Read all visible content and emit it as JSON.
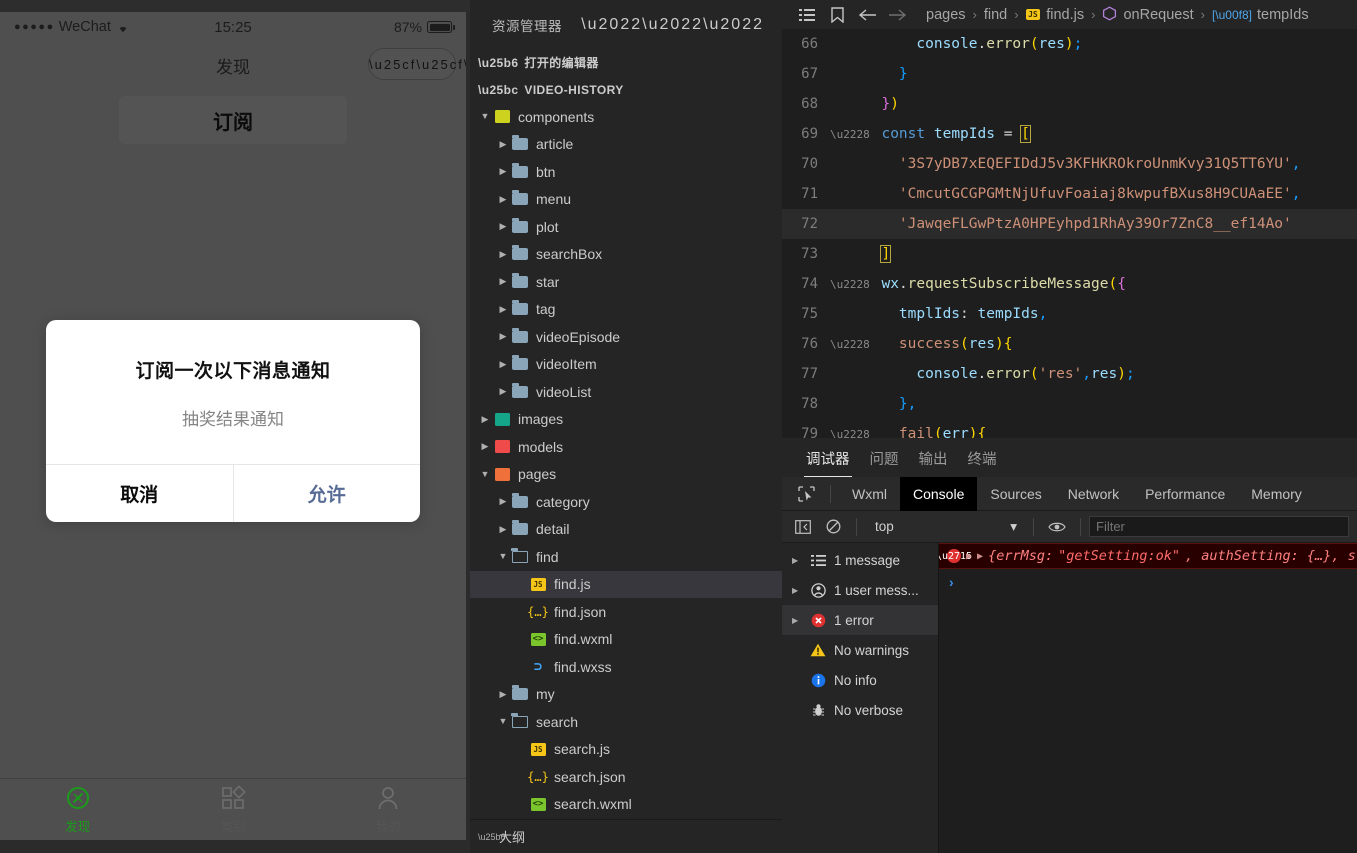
{
  "simulator": {
    "status_bar": {
      "signal_dots": "●●●●●",
      "carrier": "WeChat",
      "wifi_icon": "wifi-icon",
      "time": "15:25",
      "battery_percent": "87%"
    },
    "nav": {
      "title": "发现",
      "capsule_more_icon": "more-dots-icon",
      "capsule_target_icon": "target-icon"
    },
    "subscribe_button": "订阅",
    "modal": {
      "title": "订阅一次以下消息通知",
      "subtitle": "抽奖结果通知",
      "cancel_label": "取消",
      "allow_label": "允许",
      "allow_color": "#576b95"
    },
    "tabbar": [
      {
        "label": "发现",
        "icon": "compass-icon",
        "active": true,
        "color": "#1a9c1a"
      },
      {
        "label": "类别",
        "icon": "grid-icon",
        "active": false,
        "color": "#555555"
      },
      {
        "label": "我的",
        "icon": "person-icon",
        "active": false,
        "color": "#555555"
      }
    ]
  },
  "explorer": {
    "title": "资源管理器",
    "more_icon": "ellipsis-icon",
    "open_editors_label": "打开的编辑器",
    "project_label": "VIDEO-HISTORY",
    "outline_label": "大纲",
    "tree": [
      {
        "label": "components",
        "indent": 1,
        "kind": "folder-special",
        "icon": "folder-components-icon",
        "twisty": "down",
        "selected": false
      },
      {
        "label": "article",
        "indent": 2,
        "kind": "folder",
        "icon": "folder-icon",
        "twisty": "right",
        "selected": false
      },
      {
        "label": "btn",
        "indent": 2,
        "kind": "folder",
        "icon": "folder-icon",
        "twisty": "right",
        "selected": false
      },
      {
        "label": "menu",
        "indent": 2,
        "kind": "folder",
        "icon": "folder-icon",
        "twisty": "right",
        "selected": false
      },
      {
        "label": "plot",
        "indent": 2,
        "kind": "folder",
        "icon": "folder-icon",
        "twisty": "right",
        "selected": false
      },
      {
        "label": "searchBox",
        "indent": 2,
        "kind": "folder",
        "icon": "folder-icon",
        "twisty": "right",
        "selected": false
      },
      {
        "label": "star",
        "indent": 2,
        "kind": "folder",
        "icon": "folder-icon",
        "twisty": "right",
        "selected": false
      },
      {
        "label": "tag",
        "indent": 2,
        "kind": "folder",
        "icon": "folder-icon",
        "twisty": "right",
        "selected": false
      },
      {
        "label": "videoEpisode",
        "indent": 2,
        "kind": "folder",
        "icon": "folder-icon",
        "twisty": "right",
        "selected": false
      },
      {
        "label": "videoItem",
        "indent": 2,
        "kind": "folder",
        "icon": "folder-icon",
        "twisty": "right",
        "selected": false
      },
      {
        "label": "videoList",
        "indent": 2,
        "kind": "folder",
        "icon": "folder-icon",
        "twisty": "right",
        "selected": false
      },
      {
        "label": "images",
        "indent": 1,
        "kind": "folder-images",
        "icon": "folder-images-icon",
        "twisty": "right",
        "selected": false
      },
      {
        "label": "models",
        "indent": 1,
        "kind": "folder-models",
        "icon": "folder-models-icon",
        "twisty": "right",
        "selected": false
      },
      {
        "label": "pages",
        "indent": 1,
        "kind": "folder-pages",
        "icon": "folder-pages-icon",
        "twisty": "down",
        "selected": false
      },
      {
        "label": "category",
        "indent": 2,
        "kind": "folder",
        "icon": "folder-icon",
        "twisty": "right",
        "selected": false
      },
      {
        "label": "detail",
        "indent": 2,
        "kind": "folder",
        "icon": "folder-icon",
        "twisty": "right",
        "selected": false
      },
      {
        "label": "find",
        "indent": 2,
        "kind": "folder-open",
        "icon": "folder-open-icon",
        "twisty": "down",
        "selected": false
      },
      {
        "label": "find.js",
        "indent": 3,
        "kind": "js",
        "icon": "js-file-icon",
        "twisty": "none",
        "selected": true
      },
      {
        "label": "find.json",
        "indent": 3,
        "kind": "json",
        "icon": "json-file-icon",
        "twisty": "none",
        "selected": false
      },
      {
        "label": "find.wxml",
        "indent": 3,
        "kind": "wxml",
        "icon": "wxml-file-icon",
        "twisty": "none",
        "selected": false
      },
      {
        "label": "find.wxss",
        "indent": 3,
        "kind": "wxss",
        "icon": "wxss-file-icon",
        "twisty": "none",
        "selected": false
      },
      {
        "label": "my",
        "indent": 2,
        "kind": "folder",
        "icon": "folder-icon",
        "twisty": "right",
        "selected": false
      },
      {
        "label": "search",
        "indent": 2,
        "kind": "folder-open",
        "icon": "folder-open-icon",
        "twisty": "down",
        "selected": false
      },
      {
        "label": "search.js",
        "indent": 3,
        "kind": "js",
        "icon": "js-file-icon",
        "twisty": "none",
        "selected": false
      },
      {
        "label": "search.json",
        "indent": 3,
        "kind": "json",
        "icon": "json-file-icon",
        "twisty": "none",
        "selected": false
      },
      {
        "label": "search.wxml",
        "indent": 3,
        "kind": "wxml",
        "icon": "wxml-file-icon",
        "twisty": "none",
        "selected": false
      }
    ]
  },
  "editor": {
    "toolbar_icons": [
      "list-icon",
      "bookmark-icon",
      "arrow-left-icon",
      "arrow-right-icon"
    ],
    "breadcrumb": {
      "part1": "pages",
      "part2": "find",
      "file": "find.js",
      "symbol1": "onRequest",
      "symbol2": "tempIds",
      "separator": "›"
    },
    "lines": [
      {
        "no": "66",
        "fold": "",
        "highlight": false
      },
      {
        "no": "67",
        "fold": "",
        "highlight": false
      },
      {
        "no": "68",
        "fold": "",
        "highlight": false
      },
      {
        "no": "69",
        "fold": "v",
        "highlight": false
      },
      {
        "no": "70",
        "fold": "",
        "highlight": false
      },
      {
        "no": "71",
        "fold": "",
        "highlight": false
      },
      {
        "no": "72",
        "fold": "",
        "highlight": true
      },
      {
        "no": "73",
        "fold": "",
        "highlight": false
      },
      {
        "no": "74",
        "fold": "v",
        "highlight": false
      },
      {
        "no": "75",
        "fold": "",
        "highlight": false
      },
      {
        "no": "76",
        "fold": "v",
        "highlight": false
      },
      {
        "no": "77",
        "fold": "",
        "highlight": false
      },
      {
        "no": "78",
        "fold": "",
        "highlight": false
      },
      {
        "no": "79",
        "fold": "v",
        "highlight": false
      }
    ],
    "code": {
      "l66_console": "console",
      "l66_error": "error",
      "l66_res": "res",
      "l68": "})",
      "l69_const": "const",
      "l69_name": "tempIds",
      "tempid_1": "'3S7yDB7xEQEFIDdJ5v3KFHKROkroUnmKvy31Q5TT6YU'",
      "tempid_2": "'CmcutGCGPGMtNjUfuvFoaiaj8kwpufBXus8H9CUAaEE'",
      "tempid_3": "'JawqeFLGwPtzA0HPEyhpd1RhAy39Or7ZnC8__ef14Ao'",
      "l74_wx": "wx",
      "l74_call": "requestSubscribeMessage",
      "l75_key": "tmplIds",
      "l75_val": "tempIds",
      "l76_success": "success",
      "l76_arg": "res",
      "l77_console": "console",
      "l77_error": "error",
      "l77_str": "'res'",
      "l77_res": "res",
      "l79_fail": "fail",
      "l79_arg": "err"
    }
  },
  "devtools": {
    "panel_tabs": [
      {
        "label": "调试器",
        "active": true
      },
      {
        "label": "问题",
        "active": false
      },
      {
        "label": "输出",
        "active": false
      },
      {
        "label": "终端",
        "active": false
      }
    ],
    "inspect_icon": "inspect-cursor-icon",
    "sub_tabs": [
      {
        "label": "Wxml",
        "active": false
      },
      {
        "label": "Console",
        "active": true
      },
      {
        "label": "Sources",
        "active": false
      },
      {
        "label": "Network",
        "active": false
      },
      {
        "label": "Performance",
        "active": false
      },
      {
        "label": "Memory",
        "active": false
      }
    ],
    "filter_bar": {
      "sidebar_toggle_icon": "panel-toggle-icon",
      "clear_icon": "clear-console-icon",
      "context_value": "top",
      "context_caret": "▾",
      "eye_icon": "eye-icon",
      "filter_placeholder": "Filter",
      "filter_value": ""
    },
    "sidebar": [
      {
        "label": "1 message",
        "icon": "list-icon",
        "twisty": true,
        "selected": false
      },
      {
        "label": "1 user mess...",
        "icon": "user-icon",
        "twisty": true,
        "selected": false
      },
      {
        "label": "1 error",
        "icon": "error-icon",
        "twisty": true,
        "selected": true
      },
      {
        "label": "No warnings",
        "icon": "warning-icon",
        "twisty": false,
        "selected": false
      },
      {
        "label": "No info",
        "icon": "info-icon",
        "twisty": false,
        "selected": false
      },
      {
        "label": "No verbose",
        "icon": "verbose-icon",
        "twisty": false,
        "selected": false
      }
    ],
    "console": {
      "error_badge_icon": "error-circle-icon",
      "error_caret1": "▶",
      "error_caret2": "▶",
      "error_prefix": "{errMsg: ",
      "error_value": "\"getSetting:ok\"",
      "error_mid": ", authSetting: {…}, s",
      "prompt_caret": "›"
    }
  }
}
